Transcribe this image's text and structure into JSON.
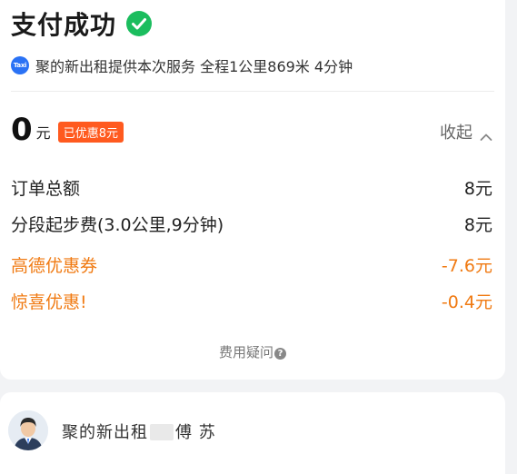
{
  "header": {
    "title": "支付成功",
    "service_icon": "Taxi",
    "service_text": "聚的新出租提供本次服务 全程1公里869米 4分钟"
  },
  "payment": {
    "amount": "0",
    "unit": "元",
    "discount_badge": "已优惠8元",
    "collapse_label": "收起"
  },
  "fees": [
    {
      "label": "订单总额",
      "value": "8元",
      "highlight": false
    },
    {
      "label": "分段起步费(3.0公里,9分钟)",
      "value": "8元",
      "highlight": false
    },
    {
      "label": "高德优惠券",
      "value": "-7.6元",
      "highlight": true
    },
    {
      "label": "惊喜优惠!",
      "value": "-0.4元",
      "highlight": true
    }
  ],
  "fee_question": "费用疑问",
  "driver": {
    "name_prefix": "聚的新出租",
    "name_suffix": "傅 苏"
  },
  "colors": {
    "success_green": "#1bbd5e",
    "accent_orange": "#f07a12",
    "badge_orange": "#ff5a1f",
    "taxi_blue": "#2a72f5"
  }
}
